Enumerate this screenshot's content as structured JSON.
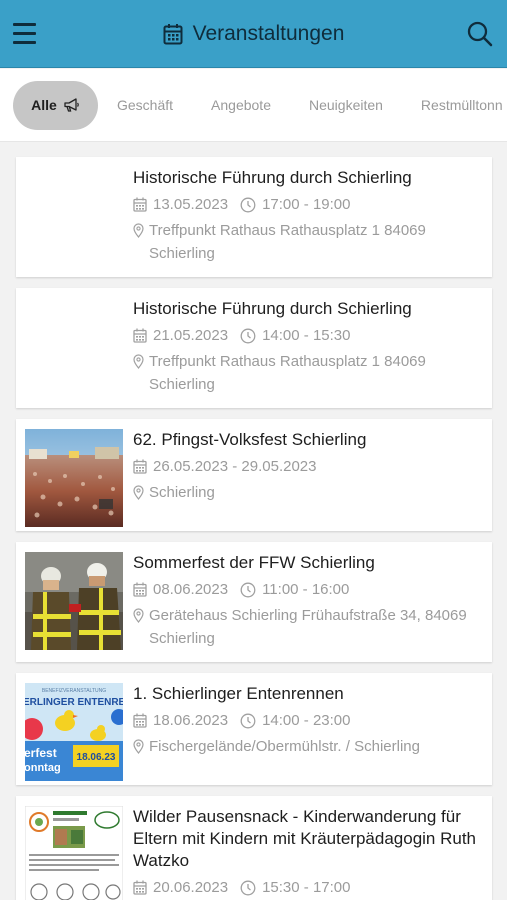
{
  "header": {
    "title": "Veranstaltungen",
    "menu_icon": "hamburger-icon",
    "calendar_icon": "calendar-icon",
    "search_icon": "search-icon",
    "background": "#3aa0c8"
  },
  "tabs": [
    {
      "label": "Alle",
      "icon": "megaphone-icon",
      "active": true
    },
    {
      "label": "Geschäft"
    },
    {
      "label": "Angebote"
    },
    {
      "label": "Neuigkeiten"
    },
    {
      "label": "Restmülltonn"
    }
  ],
  "events": [
    {
      "title": "Historische Führung durch Schierling",
      "date": "13.05.2023",
      "time": "17:00 - 19:00",
      "location": "Treffpunkt Rathaus Rathausplatz 1 84069 Schierling",
      "image": "none"
    },
    {
      "title": "Historische Führung durch Schierling",
      "date": "21.05.2023",
      "time": "14:00 - 15:30",
      "location": "Treffpunkt Rathaus Rathausplatz 1 84069 Schierling",
      "image": "none"
    },
    {
      "title": "62. Pfingst-Volksfest Schierling",
      "date": "26.05.2023 - 29.05.2023",
      "time": "",
      "location": "Schierling",
      "image": "crowd-photo"
    },
    {
      "title": "Sommerfest der FFW Schierling",
      "date": "08.06.2023",
      "time": "11:00 - 16:00",
      "location": "Gerätehaus Schierling Frühaufstraße 34, 84069 Schierling",
      "image": "firefighters-photo"
    },
    {
      "title": "1. Schierlinger Entenrennen",
      "date": "18.06.2023",
      "time": "14:00 - 23:00",
      "location": "Fischergelände/Obermühlstr. / Schierling",
      "image": "duck-race-poster",
      "poster_text": {
        "top": "BENEFIZVERANSTALTUNG",
        "banner": "ERLINGER ENTENRE",
        "fest": "erfest",
        "sonntag": "onntag",
        "date": "18.06.23"
      }
    },
    {
      "title": "Wilder Pausensnack - Kinderwanderung für Eltern mit Kindern mit Kräuterpädagogin Ruth Watzko",
      "date": "20.06.2023",
      "time": "15:30 - 17:00",
      "location": "",
      "image": "flyer-photo"
    }
  ]
}
